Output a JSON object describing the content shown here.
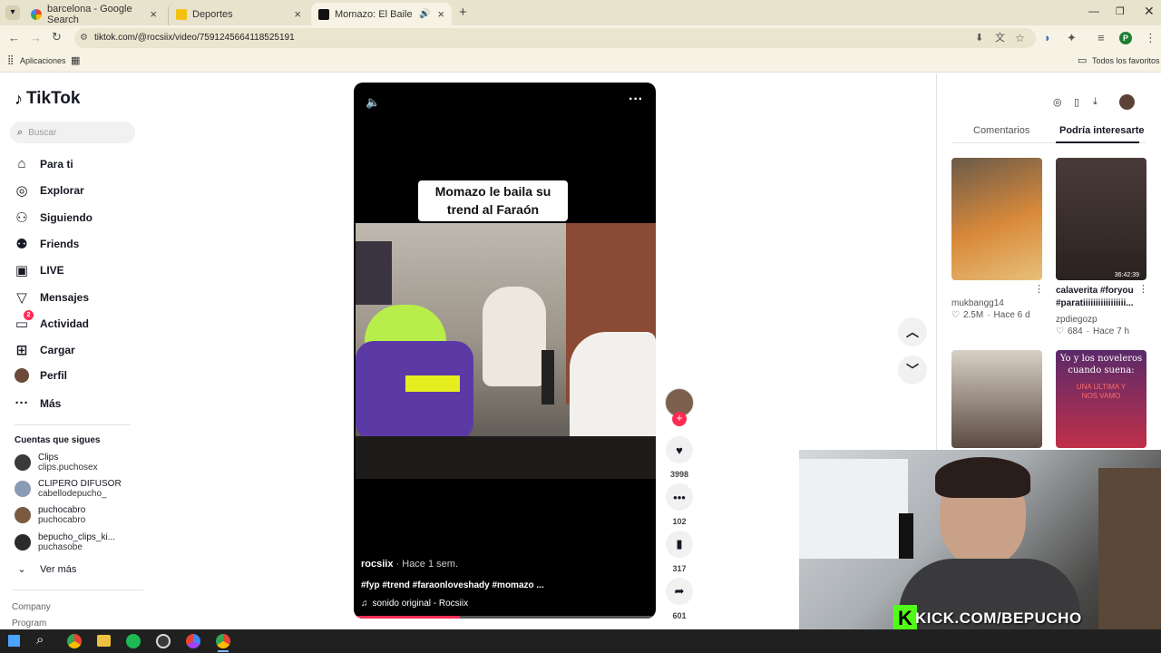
{
  "browser": {
    "tabs": [
      {
        "title": "barcelona - Google Search",
        "favicon": "google-icon"
      },
      {
        "title": "Deportes",
        "favicon": "star-icon"
      },
      {
        "title": "Momazo: El Baile del Faraó",
        "favicon": "tiktok-icon"
      }
    ],
    "url": "tiktok.com/@rocsiix/video/7591245664118525191",
    "bookmarks": {
      "apps": "Aplicaciones",
      "all": "Todos los favoritos"
    },
    "profile_initial": "P"
  },
  "sidebar": {
    "logo": "TikTok",
    "search_placeholder": "Buscar",
    "nav": [
      {
        "label": "Para ti",
        "icon": "home-icon"
      },
      {
        "label": "Explorar",
        "icon": "compass-icon"
      },
      {
        "label": "Siguiendo",
        "icon": "following-icon"
      },
      {
        "label": "Friends",
        "icon": "friends-icon"
      },
      {
        "label": "LIVE",
        "icon": "live-icon"
      },
      {
        "label": "Mensajes",
        "icon": "messages-icon"
      },
      {
        "label": "Actividad",
        "icon": "activity-icon",
        "badge": "2"
      },
      {
        "label": "Cargar",
        "icon": "upload-icon"
      },
      {
        "label": "Perfil",
        "icon": "profile-avatar"
      },
      {
        "label": "Más",
        "icon": "more-icon"
      }
    ],
    "following_title": "Cuentas que sigues",
    "following": [
      {
        "name": "Clips",
        "handle": "clips.puchosex"
      },
      {
        "name": "CLIPERO DIFUSOR",
        "handle": "cabellodepucho_"
      },
      {
        "name": "puchocabro",
        "handle": "puchocabro"
      },
      {
        "name": "bepucho_clips_ki...",
        "handle": "puchasobe"
      }
    ],
    "see_more": "Ver más",
    "footer": [
      "Company",
      "Program"
    ]
  },
  "video": {
    "caption_overlay": "Momazo le baila su trend al Faraón",
    "author": "rocsiix",
    "time": "· Hace 1 sem.",
    "description": "#fyp #trend #faraonloveshady #momazo ...",
    "sound": "sonido original - Rocsiix",
    "progress": 0.35,
    "likes": "3998",
    "comments": "102",
    "saves": "317",
    "shares": "601"
  },
  "right_panel": {
    "tabs": [
      "Comentarios",
      "Podría interesarte"
    ],
    "active_tab": 1,
    "items": [
      {
        "user": "mukbangg14",
        "likes": "2.5M",
        "time": "Hace 6 d",
        "title": ""
      },
      {
        "user": "zpdiegozp",
        "likes": "684",
        "time": "Hace 7 h",
        "title": "calaverita #foryou #paratiiiiiiiiiiiiiiiii...",
        "duration": "36:42:39"
      },
      {
        "title": "Yo y los noveleros cuando suena:",
        "overlay": "UNA ULTIMA Y NOS VAMO"
      }
    ]
  },
  "webcam": {
    "overlay_text": "KICK.COM/BEPUCHO",
    "logo": "K"
  },
  "colors": {
    "accent": "#fe2c55",
    "kick_green": "#53fc18"
  }
}
